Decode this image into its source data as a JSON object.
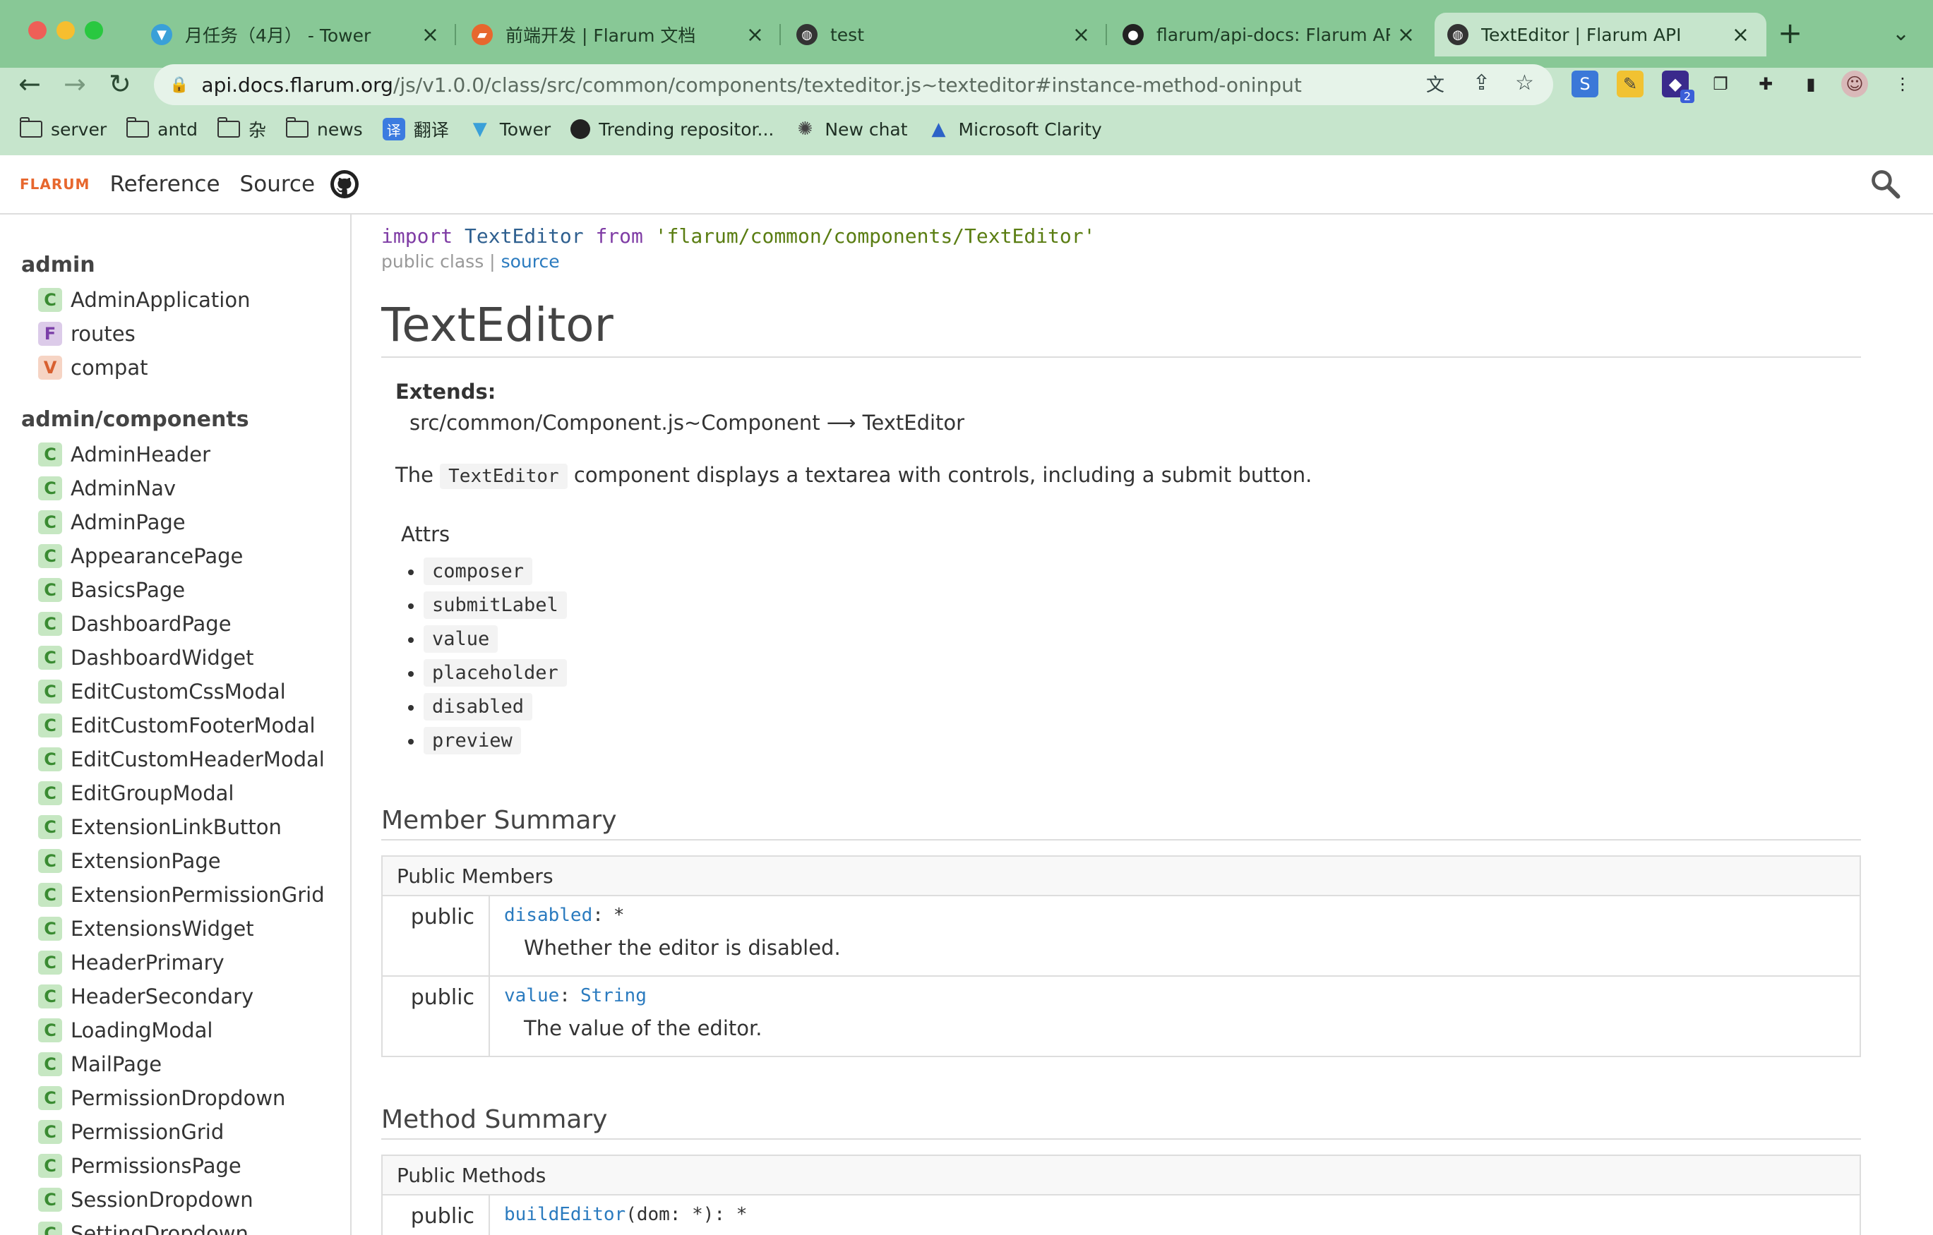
{
  "browser": {
    "tabs": [
      {
        "title": "月任务（4月） - Tower",
        "favicon": "tower-icon",
        "color": "#3aa0d8",
        "active": false
      },
      {
        "title": "前端开发 | Flarum 文档",
        "favicon": "flarum-icon",
        "color": "#e7672e",
        "active": false
      },
      {
        "title": "test",
        "favicon": "globe-icon",
        "color": "#333333",
        "active": false
      },
      {
        "title": "flarum/api-docs: Flarum API D",
        "favicon": "github-icon",
        "color": "#222222",
        "active": false
      },
      {
        "title": "TextEditor | Flarum API",
        "favicon": "globe-icon",
        "color": "#333333",
        "active": true
      }
    ],
    "url_host": "api.docs.flarum.org",
    "url_path": "/js/v1.0.0/class/src/common/components/texteditor.js~texteditor#instance-method-oninput",
    "extension_badge": "2",
    "bookmarks": [
      {
        "label": "server",
        "icon": "folder-icon"
      },
      {
        "label": "antd",
        "icon": "folder-icon"
      },
      {
        "label": "杂",
        "icon": "folder-icon"
      },
      {
        "label": "news",
        "icon": "folder-icon"
      },
      {
        "label": "翻译",
        "icon": "translate-icon",
        "glyph": "译"
      },
      {
        "label": "Tower",
        "icon": "tower-icon"
      },
      {
        "label": "Trending repositor...",
        "icon": "github-icon"
      },
      {
        "label": "New chat",
        "icon": "openai-icon"
      },
      {
        "label": "Microsoft Clarity",
        "icon": "clarity-icon"
      }
    ]
  },
  "header": {
    "logo": "FLARUM",
    "nav": [
      "Reference",
      "Source"
    ]
  },
  "sidebar": {
    "groups": [
      {
        "name": "admin",
        "items": [
          {
            "kind": "C",
            "label": "AdminApplication"
          },
          {
            "kind": "F",
            "label": "routes"
          },
          {
            "kind": "V",
            "label": "compat"
          }
        ]
      },
      {
        "name": "admin/components",
        "items": [
          {
            "kind": "C",
            "label": "AdminHeader"
          },
          {
            "kind": "C",
            "label": "AdminNav"
          },
          {
            "kind": "C",
            "label": "AdminPage"
          },
          {
            "kind": "C",
            "label": "AppearancePage"
          },
          {
            "kind": "C",
            "label": "BasicsPage"
          },
          {
            "kind": "C",
            "label": "DashboardPage"
          },
          {
            "kind": "C",
            "label": "DashboardWidget"
          },
          {
            "kind": "C",
            "label": "EditCustomCssModal"
          },
          {
            "kind": "C",
            "label": "EditCustomFooterModal"
          },
          {
            "kind": "C",
            "label": "EditCustomHeaderModal"
          },
          {
            "kind": "C",
            "label": "EditGroupModal"
          },
          {
            "kind": "C",
            "label": "ExtensionLinkButton"
          },
          {
            "kind": "C",
            "label": "ExtensionPage"
          },
          {
            "kind": "C",
            "label": "ExtensionPermissionGrid"
          },
          {
            "kind": "C",
            "label": "ExtensionsWidget"
          },
          {
            "kind": "C",
            "label": "HeaderPrimary"
          },
          {
            "kind": "C",
            "label": "HeaderSecondary"
          },
          {
            "kind": "C",
            "label": "LoadingModal"
          },
          {
            "kind": "C",
            "label": "MailPage"
          },
          {
            "kind": "C",
            "label": "PermissionDropdown"
          },
          {
            "kind": "C",
            "label": "PermissionGrid"
          },
          {
            "kind": "C",
            "label": "PermissionsPage"
          },
          {
            "kind": "C",
            "label": "SessionDropdown"
          },
          {
            "kind": "C",
            "label": "SettingDropdown"
          }
        ]
      }
    ]
  },
  "content": {
    "import_kw": "import",
    "import_name": "TextEditor",
    "import_from": "from",
    "import_path": "'flarum/common/components/TextEditor'",
    "meta_prefix": "public class |",
    "meta_source": "source",
    "title": "TextEditor",
    "extends_label": "Extends:",
    "extends_value": "src/common/Component.js~Component ⟶ TextEditor",
    "desc_before": "The",
    "desc_code": "TextEditor",
    "desc_after": "component displays a textarea with controls, including a submit button.",
    "attrs_label": "Attrs",
    "attrs": [
      "composer",
      "submitLabel",
      "value",
      "placeholder",
      "disabled",
      "preview"
    ],
    "member_summary_title": "Member Summary",
    "public_members_header": "Public Members",
    "members": [
      {
        "access": "public",
        "name": "disabled",
        "sep": ":",
        "type": "*",
        "desc": "Whether the editor is disabled."
      },
      {
        "access": "public",
        "name": "value",
        "sep": ":",
        "type": "String",
        "desc": "The value of the editor."
      }
    ],
    "method_summary_title": "Method Summary",
    "public_methods_header": "Public Methods",
    "methods": [
      {
        "access": "public",
        "name": "buildEditor",
        "params": "(dom: *): *"
      }
    ]
  }
}
